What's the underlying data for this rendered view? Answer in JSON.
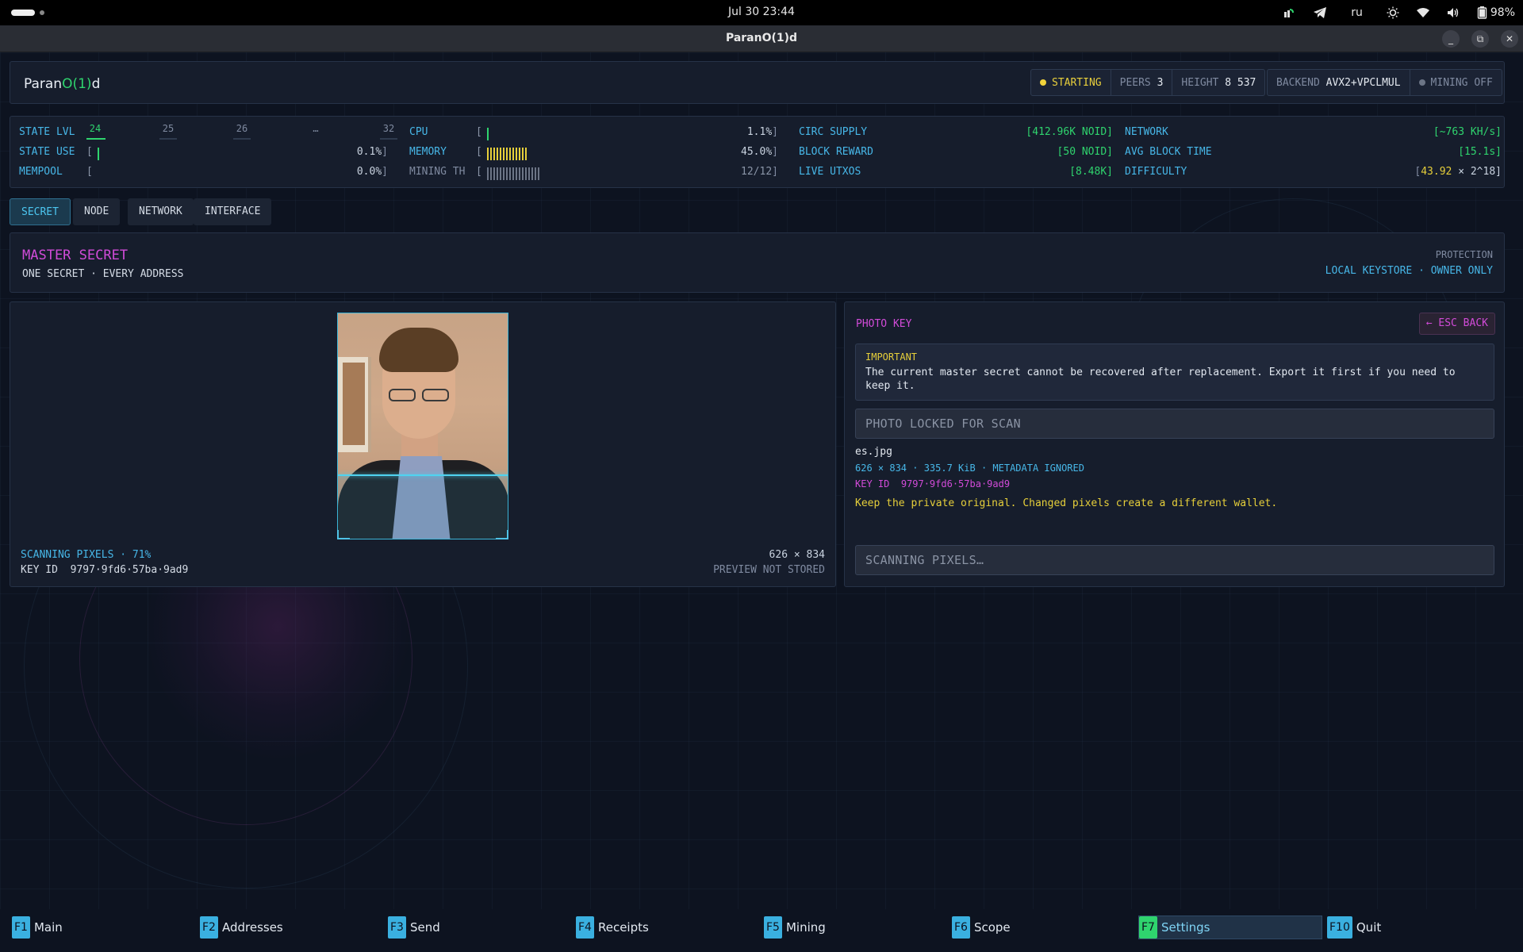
{
  "system": {
    "clock": "Jul 30  23:44",
    "keyboard_layout": "ru",
    "battery": "98%"
  },
  "window": {
    "title": "ParanO(1)d",
    "minimize": "_",
    "restore": "⧉",
    "close": "✕"
  },
  "header": {
    "brand_pre": "Paran",
    "brand_mid": "O(1)",
    "brand_post": "d",
    "status": "STARTING",
    "peers_label": "PEERS",
    "peers_value": "3",
    "height_label": "HEIGHT",
    "height_value": "8 537",
    "backend_label": "BACKEND",
    "backend_value": "AVX2+VPCLMUL",
    "mining": "MINING OFF"
  },
  "stats": {
    "state_lvl_label": "STATE LVL",
    "levels": [
      "24",
      "25",
      "26",
      "…",
      "32"
    ],
    "state_use_label": "STATE USE",
    "state_use_value": "0.1%",
    "state_use_fraction": 0.001,
    "mempool_label": "MEMPOOL",
    "mempool_value": "0.0%",
    "mempool_fraction": 0.0,
    "cpu_label": "CPU",
    "cpu_value": "1.1%",
    "cpu_fraction": 0.011,
    "memory_label": "MEMORY",
    "memory_value": "45.0%",
    "memory_fraction": 0.45,
    "mining_th_label": "MINING TH",
    "mining_th_value": "12/12",
    "circ_supply_label": "CIRC SUPPLY",
    "circ_supply_value": "[412.96K NOID]",
    "block_reward_label": "BLOCK REWARD",
    "block_reward_value": "[50 NOID]",
    "live_utxos_label": "LIVE UTXOS",
    "live_utxos_value": "[8.48K]",
    "network_label": "NETWORK",
    "network_value": "[~763 KH/s]",
    "avg_block_time_label": "AVG BLOCK TIME",
    "avg_block_time_value": "[15.1s]",
    "difficulty_label": "DIFFICULTY",
    "difficulty_value": "43.92",
    "difficulty_suffix": "× 2^18]",
    "difficulty_open": "[",
    "bracket_open": "[",
    "bracket_close": "]"
  },
  "tabs": [
    {
      "label": "SECRET"
    },
    {
      "label": "NODE"
    },
    {
      "label": "NETWORK"
    },
    {
      "label": "INTERFACE"
    }
  ],
  "secret": {
    "title": "MASTER SECRET",
    "subtitle": "ONE SECRET · EVERY ADDRESS",
    "protection_label": "PROTECTION",
    "protection_value": "LOCAL KEYSTORE · OWNER ONLY"
  },
  "preview": {
    "scan_status": "SCANNING PIXELS · 71%",
    "scan_progress": 0.71,
    "key_id_label": "KEY ID",
    "key_id_value": "9797·9fd6·57ba·9ad9",
    "dimensions": "626 × 834",
    "note": "PREVIEW NOT STORED"
  },
  "photo_key": {
    "title": "PHOTO KEY",
    "back_button": "← ESC BACK",
    "important_title": "IMPORTANT",
    "important_text": "The current master secret cannot be recovered after replacement. Export it first if you need to keep it.",
    "locked_field": "PHOTO LOCKED FOR SCAN",
    "filename": "es.jpg",
    "file_meta": "626 × 834 · 335.7 KiB · METADATA IGNORED",
    "key_id_label": "KEY ID",
    "key_id_value": "9797·9fd6·57ba·9ad9",
    "warning": "Keep the private original. Changed pixels create a different wallet.",
    "scan_field": "SCANNING PIXELS…"
  },
  "footer": [
    {
      "key": "F1",
      "label": "Main"
    },
    {
      "key": "F2",
      "label": "Addresses"
    },
    {
      "key": "F3",
      "label": "Send"
    },
    {
      "key": "F4",
      "label": "Receipts"
    },
    {
      "key": "F5",
      "label": "Mining"
    },
    {
      "key": "F6",
      "label": "Scope"
    },
    {
      "key": "F7",
      "label": "Settings"
    },
    {
      "key": "F10",
      "label": "Quit"
    }
  ],
  "colors": {
    "accent_cyan": "#47b7e8",
    "accent_green": "#2fd46e",
    "accent_magenta": "#d14bd8",
    "accent_yellow": "#e6cf3a"
  }
}
